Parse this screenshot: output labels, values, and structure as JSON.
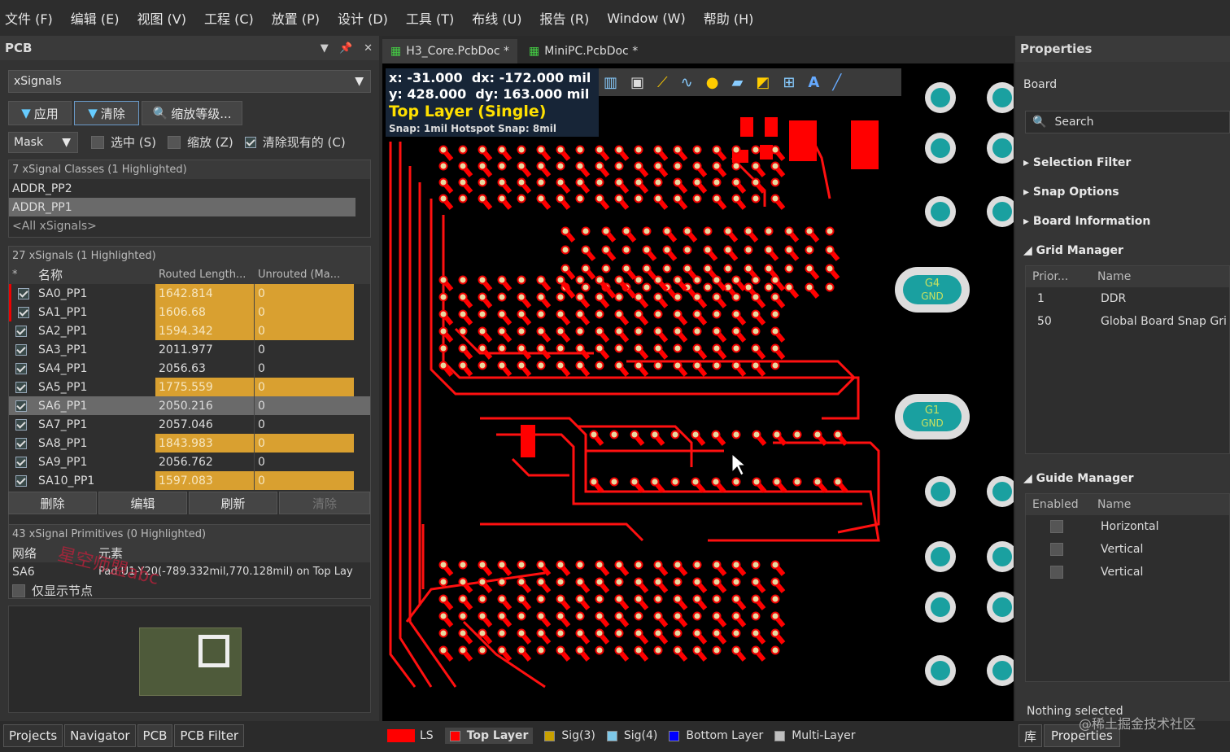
{
  "menu": [
    "文件 (F)",
    "编辑 (E)",
    "视图 (V)",
    "工程 (C)",
    "放置 (P)",
    "设计 (D)",
    "工具 (T)",
    "布线 (U)",
    "报告 (R)",
    "Window (W)",
    "帮助 (H)"
  ],
  "pcb_panel": {
    "title": "PCB",
    "type_select": "xSignals",
    "apply_label": "应用",
    "clear_label": "清除",
    "zoom_label": "缩放等级...",
    "mask_select": "Mask",
    "select_label": "选中 (S)",
    "zoom_chk_label": "缩放 (Z)",
    "clear_existing_label": "清除现有的 (C)",
    "classes_header": "7 xSignal Classes (1 Highlighted)",
    "classes": [
      "ADDR_PP2",
      "ADDR_PP1",
      "<All xSignals>"
    ],
    "signals_header": "27 xSignals (1 Highlighted)",
    "col_star": "*",
    "col_name": "名称",
    "col_routed": "Routed Length...",
    "col_unrouted": "Unrouted (Ma...",
    "signals": [
      {
        "name": "SA0_PP1",
        "routed": "1642.814",
        "unrouted": "0"
      },
      {
        "name": "SA1_PP1",
        "routed": "1606.68",
        "unrouted": "0"
      },
      {
        "name": "SA2_PP1",
        "routed": "1594.342",
        "unrouted": "0"
      },
      {
        "name": "SA3_PP1",
        "routed": "2011.977",
        "unrouted": "0"
      },
      {
        "name": "SA4_PP1",
        "routed": "2056.63",
        "unrouted": "0"
      },
      {
        "name": "SA5_PP1",
        "routed": "1775.559",
        "unrouted": "0"
      },
      {
        "name": "SA6_PP1",
        "routed": "2050.216",
        "unrouted": "0"
      },
      {
        "name": "SA7_PP1",
        "routed": "2057.046",
        "unrouted": "0"
      },
      {
        "name": "SA8_PP1",
        "routed": "1843.983",
        "unrouted": "0"
      },
      {
        "name": "SA9_PP1",
        "routed": "2056.762",
        "unrouted": "0"
      },
      {
        "name": "SA10_PP1",
        "routed": "1597.083",
        "unrouted": "0"
      }
    ],
    "delete_label": "删除",
    "edit_label": "编辑",
    "refresh_label": "刷新",
    "clear2_label": "清除",
    "primitives_header": "43 xSignal Primitives (0 Highlighted)",
    "col_net": "网络",
    "col_element": "元素",
    "prim_net": "SA6",
    "prim_element": "Pad U1-Y20(-789.332mil,770.128mil) on Top Lay",
    "show_nodes_label": "仅显示节点",
    "watermark": "星空师盟abc"
  },
  "tabs": [
    "H3_Core.PcbDoc *",
    "MiniPC.PcbDoc *"
  ],
  "hud": {
    "x_label": "x:",
    "x_val": "-31.000",
    "dx_label": "dx:",
    "dx_val": "-172.000 mil",
    "y_label": "y:",
    "y_val": "428.000",
    "dy_label": "dy:",
    "dy_val": "163.000 mil",
    "layer": "Top Layer (Single)",
    "snap": "Snap: 1mil Hotspot Snap: 8mil"
  },
  "pads": {
    "g4": "G4",
    "g1": "G1",
    "gnd": "GND"
  },
  "properties": {
    "title": "Properties",
    "board": "Board",
    "search": "Search",
    "selection_filter": "Selection Filter",
    "snap_options": "Snap Options",
    "board_information": "Board Information",
    "grid_manager": "Grid Manager",
    "grid_col_prior": "Prior...",
    "grid_col_name": "Name",
    "grids": [
      {
        "prior": "1",
        "name": "DDR"
      },
      {
        "prior": "50",
        "name": "Global Board Snap Gri"
      }
    ],
    "guide_manager": "Guide Manager",
    "guide_col_enabled": "Enabled",
    "guide_col_name": "Name",
    "guides": [
      "Horizontal",
      "Vertical",
      "Vertical"
    ],
    "nothing_selected": "Nothing selected"
  },
  "status": {
    "panel_tabs": [
      "Projects",
      "Navigator",
      "PCB",
      "PCB Filter"
    ],
    "ls": "LS",
    "layers": [
      {
        "name": "Top Layer",
        "color": "#ff0000"
      },
      {
        "name": "Sig(3)",
        "color": "#c8a000"
      },
      {
        "name": "Sig(4)",
        "color": "#7ec8e8"
      },
      {
        "name": "Bottom Layer",
        "color": "#0000ff"
      },
      {
        "name": "Multi-Layer",
        "color": "#c0c0c0"
      }
    ],
    "right_tabs": [
      "库",
      "Properties"
    ],
    "watermark2": "@稀土掘金技术社区"
  }
}
